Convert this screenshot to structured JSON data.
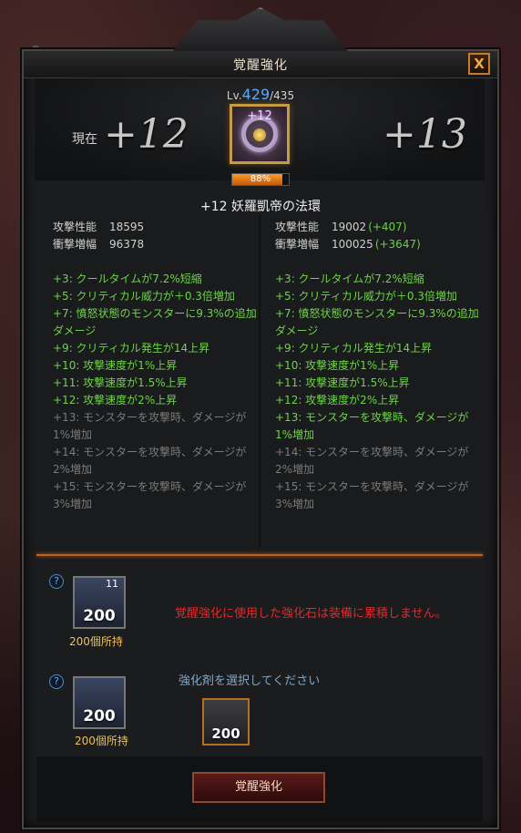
{
  "window": {
    "title": "覚醒強化",
    "close_label": "X"
  },
  "level": {
    "prefix": "Lv.",
    "current": "429",
    "max": "/435"
  },
  "current_label": "現在",
  "current_plus": "+12",
  "next_plus": "+13",
  "item": {
    "plus_label": "+12",
    "name": "+12 妖羅凱帝の法環"
  },
  "progress": {
    "percent": 88,
    "label": "88%"
  },
  "left": {
    "stats": [
      {
        "k": "攻撃性能",
        "v": "18595",
        "d": ""
      },
      {
        "k": "衝撃増幅",
        "v": "96378",
        "d": ""
      }
    ],
    "effects": [
      {
        "text": "+3: クールタイムが7.2%短縮",
        "on": true
      },
      {
        "text": "+5: クリティカル威力が＋0.3倍増加",
        "on": true
      },
      {
        "text": "+7: 憤怒状態のモンスターに9.3%の追加ダメージ",
        "on": true
      },
      {
        "text": "+9: クリティカル発生が14上昇",
        "on": true
      },
      {
        "text": "+10: 攻撃速度が1%上昇",
        "on": true
      },
      {
        "text": "+11: 攻撃速度が1.5%上昇",
        "on": true
      },
      {
        "text": "+12: 攻撃速度が2%上昇",
        "on": true
      },
      {
        "text": "+13: モンスターを攻撃時、ダメージが1%増加",
        "on": false
      },
      {
        "text": "+14: モンスターを攻撃時、ダメージが2%増加",
        "on": false
      },
      {
        "text": "+15: モンスターを攻撃時、ダメージが3%増加",
        "on": false
      }
    ]
  },
  "right": {
    "stats": [
      {
        "k": "攻撃性能",
        "v": "19002",
        "d": "(+407)"
      },
      {
        "k": "衝撃増幅",
        "v": "100025",
        "d": "(+3647)"
      }
    ],
    "effects": [
      {
        "text": "+3: クールタイムが7.2%短縮",
        "on": true
      },
      {
        "text": "+5: クリティカル威力が＋0.3倍増加",
        "on": true
      },
      {
        "text": "+7: 憤怒状態のモンスターに9.3%の追加ダメージ",
        "on": true
      },
      {
        "text": "+9: クリティカル発生が14上昇",
        "on": true
      },
      {
        "text": "+10: 攻撃速度が1%上昇",
        "on": true
      },
      {
        "text": "+11: 攻撃速度が1.5%上昇",
        "on": true
      },
      {
        "text": "+12: 攻撃速度が2%上昇",
        "on": true
      },
      {
        "text": "+13: モンスターを攻撃時、ダメージが1%増加",
        "on": true
      },
      {
        "text": "+14: モンスターを攻撃時、ダメージが2%増加",
        "on": false
      },
      {
        "text": "+15: モンスターを攻撃時、ダメージが3%増加",
        "on": false
      }
    ]
  },
  "material": {
    "help": "?",
    "stone_level": "11",
    "stone_count": "200",
    "stone_owned": "200個所持",
    "warning": "覚醒強化に使用した強化石は装備に累積しません。",
    "agent_count": "200",
    "agent_owned": "200個所持",
    "agent_hint": "強化剤を選択してください",
    "selected_count": "200"
  },
  "action": {
    "label": "覚醒強化"
  },
  "colors": {
    "accent": "#c4621a",
    "positive": "#6fd24a",
    "warning": "#e02a2a",
    "level": "#59a9ff"
  }
}
